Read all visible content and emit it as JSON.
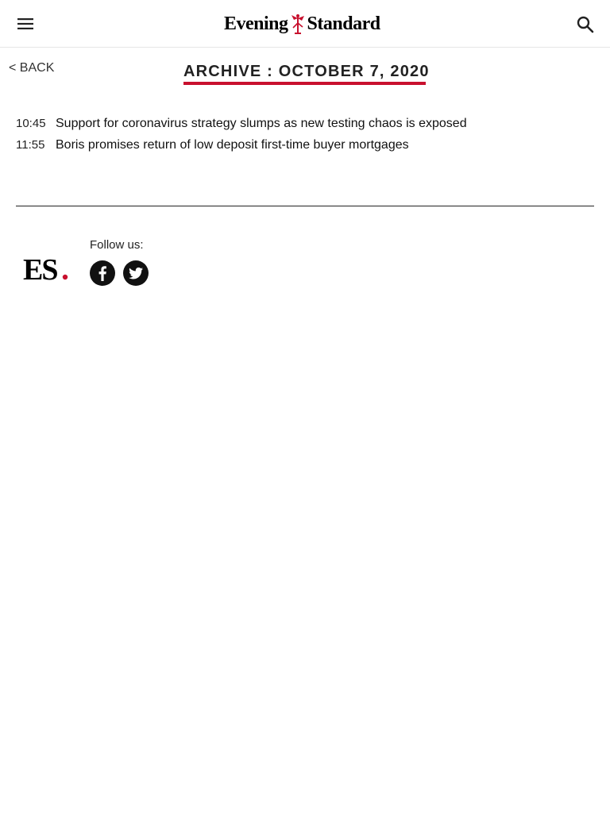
{
  "header": {
    "logo_left": "Evening",
    "logo_right": "Standard",
    "menu_icon": "hamburger-menu-icon",
    "search_icon": "search-icon",
    "accent_color": "#c8102e"
  },
  "nav": {
    "back_label": "< BACK"
  },
  "archive": {
    "title": "ARCHIVE : OCTOBER 7, 2020",
    "articles": [
      {
        "time": "10:45",
        "headline": "Support for coronavirus strategy slumps as new testing chaos is exposed"
      },
      {
        "time": "11:55",
        "headline": "Boris promises return of low deposit first-time buyer mortgages"
      }
    ]
  },
  "footer": {
    "logo_text": "ES",
    "follow_label": "Follow us:",
    "social": [
      {
        "name": "facebook",
        "icon": "facebook-icon"
      },
      {
        "name": "twitter",
        "icon": "twitter-icon"
      }
    ]
  }
}
